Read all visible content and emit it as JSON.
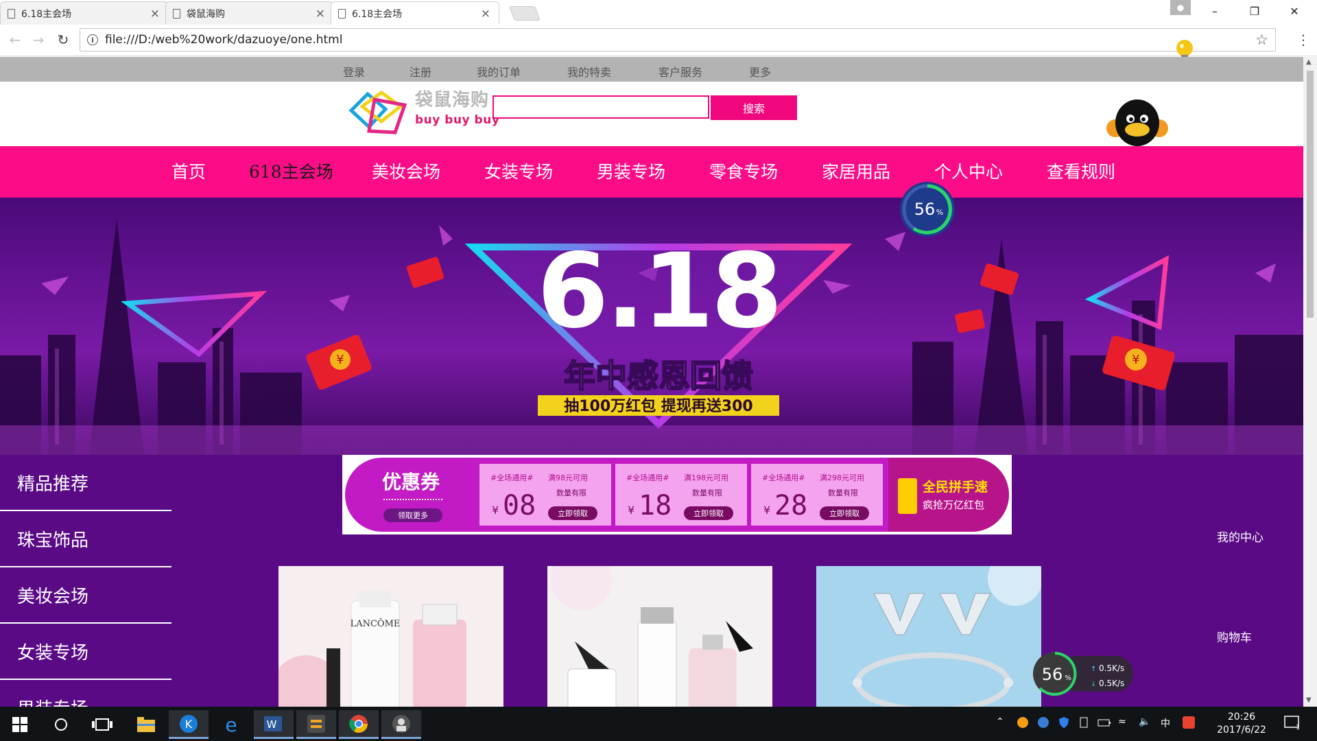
{
  "browser": {
    "tabs": [
      {
        "title": "6.18主会场",
        "active": false
      },
      {
        "title": "袋鼠海购",
        "active": false
      },
      {
        "title": "6.18主会场",
        "active": true
      }
    ],
    "url": "file:///D:/web%20work/dazuoye/one.html"
  },
  "topbar": {
    "links": [
      "登录",
      "注册",
      "我的订单",
      "我的特卖",
      "客户服务",
      "更多"
    ]
  },
  "header": {
    "logo_cn": "袋鼠海购",
    "logo_en": "buy buy buy",
    "search_value": "",
    "search_button": "搜索"
  },
  "nav": {
    "items": [
      "首页",
      "618主会场",
      "美妆会场",
      "女装专场",
      "男装专场",
      "零食专场",
      "家居用品",
      "个人中心",
      "查看规则"
    ],
    "current_index": 1
  },
  "speed_overlay": {
    "value": "56",
    "unit": "%"
  },
  "banner": {
    "headline": "6.18",
    "subtitle": "年中感恩回馈",
    "tagline": "抽100万红包 提现再送300",
    "yen_glyph": "¥"
  },
  "sidebar": {
    "items": [
      "精品推荐",
      "珠宝饰品",
      "美妆会场",
      "女装专场",
      "男装专场"
    ]
  },
  "coupons": {
    "title": "优惠券",
    "more": "领取更多",
    "items": [
      {
        "tag": "#全场通用#",
        "condition": "满98元可用",
        "limit": "数量有限",
        "currency": "¥",
        "value": "08",
        "button": "立即领取"
      },
      {
        "tag": "#全场通用#",
        "condition": "满198元可用",
        "limit": "数量有限",
        "currency": "¥",
        "value": "18",
        "button": "立即领取"
      },
      {
        "tag": "#全场通用#",
        "condition": "满298元可用",
        "limit": "数量有限",
        "currency": "¥",
        "value": "28",
        "button": "立即领取"
      }
    ],
    "promo_title": "全民拼手速",
    "promo_sub": "疯抢万亿红包"
  },
  "right_links": {
    "my_center": "我的中心",
    "cart": "购物车"
  },
  "products": [
    {
      "brand": "LANCÔME",
      "colors": [
        "#f6eef0",
        "#f3c2cf"
      ]
    },
    {
      "brand": "",
      "colors": [
        "#f2f0f1",
        "#e0dbde"
      ]
    },
    {
      "brand": "",
      "colors": [
        "#9fd0ea",
        "#c7e4f3"
      ]
    }
  ],
  "net_widget": {
    "value": "56",
    "unit": "%",
    "up": "0.5K/s",
    "down": "0.5K/s"
  },
  "taskbar": {
    "ime": "中",
    "time": "20:26",
    "date": "2017/6/22",
    "notification_count": "1"
  },
  "colors": {
    "brand_pink": "#fd0c87",
    "deep_purple": "#5b0a86",
    "coupon_magenta": "#c21ac4"
  }
}
